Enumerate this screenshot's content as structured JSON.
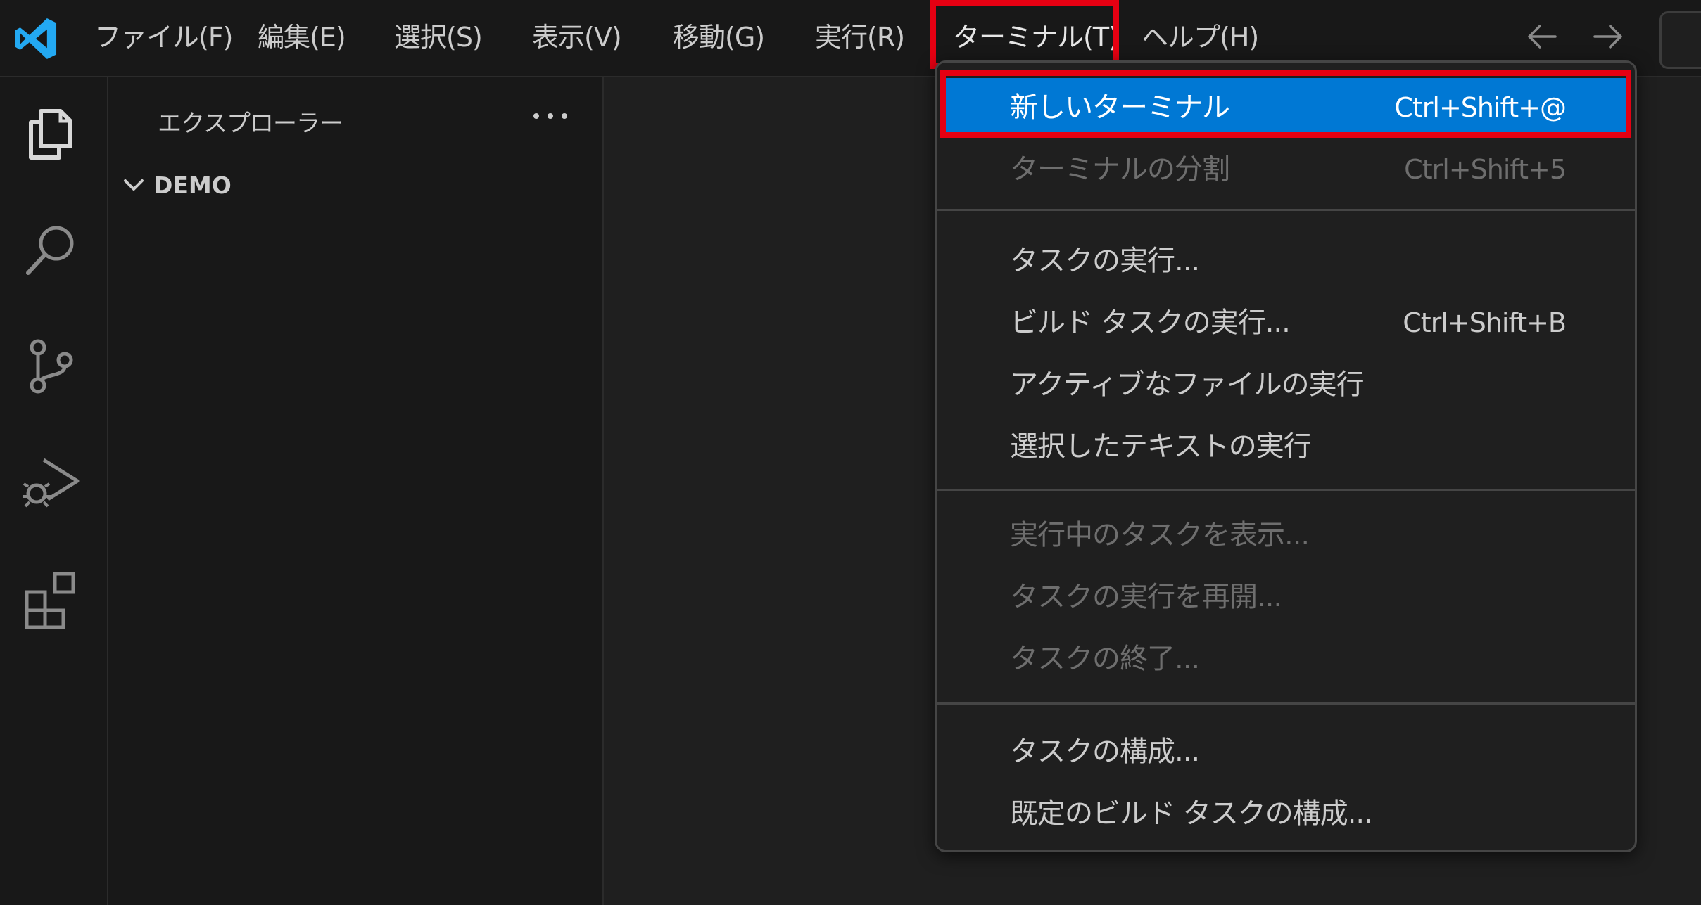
{
  "menubar": {
    "items": [
      {
        "label": "ファイル(F)"
      },
      {
        "label": "編集(E)"
      },
      {
        "label": "選択(S)"
      },
      {
        "label": "表示(V)"
      },
      {
        "label": "移動(G)"
      },
      {
        "label": "実行(R)"
      },
      {
        "label": "ターミナル(T)"
      },
      {
        "label": "ヘルプ(H)"
      }
    ],
    "active_item": "ターミナル(T)"
  },
  "sidebar": {
    "title": "エクスプローラー",
    "folder": "DEMO"
  },
  "terminal_menu": {
    "groups": [
      [
        {
          "label": "新しいターミナル",
          "shortcut": "Ctrl+Shift+@",
          "state": "highlighted"
        },
        {
          "label": "ターミナルの分割",
          "shortcut": "Ctrl+Shift+5",
          "state": "disabled"
        }
      ],
      [
        {
          "label": "タスクの実行...",
          "shortcut": ""
        },
        {
          "label": "ビルド タスクの実行...",
          "shortcut": "Ctrl+Shift+B"
        },
        {
          "label": "アクティブなファイルの実行",
          "shortcut": ""
        },
        {
          "label": "選択したテキストの実行",
          "shortcut": ""
        }
      ],
      [
        {
          "label": "実行中のタスクを表示...",
          "state": "disabled"
        },
        {
          "label": "タスクの実行を再開...",
          "state": "disabled"
        },
        {
          "label": "タスクの終了...",
          "state": "disabled"
        }
      ],
      [
        {
          "label": "タスクの構成...",
          "shortcut": ""
        },
        {
          "label": "既定のビルド タスクの構成...",
          "shortcut": ""
        }
      ]
    ]
  },
  "colors": {
    "accent": "#0078d4",
    "highlight_box": "#e60012",
    "vscode_logo": "#23a9f2",
    "background": "#1f1f1f",
    "chrome": "#181818"
  },
  "icons": [
    "vscode-logo",
    "arrow-left-icon",
    "arrow-right-icon",
    "explorer-icon",
    "search-icon",
    "source-control-icon",
    "run-debug-icon",
    "extensions-icon",
    "ellipsis-icon",
    "chevron-down-icon"
  ]
}
